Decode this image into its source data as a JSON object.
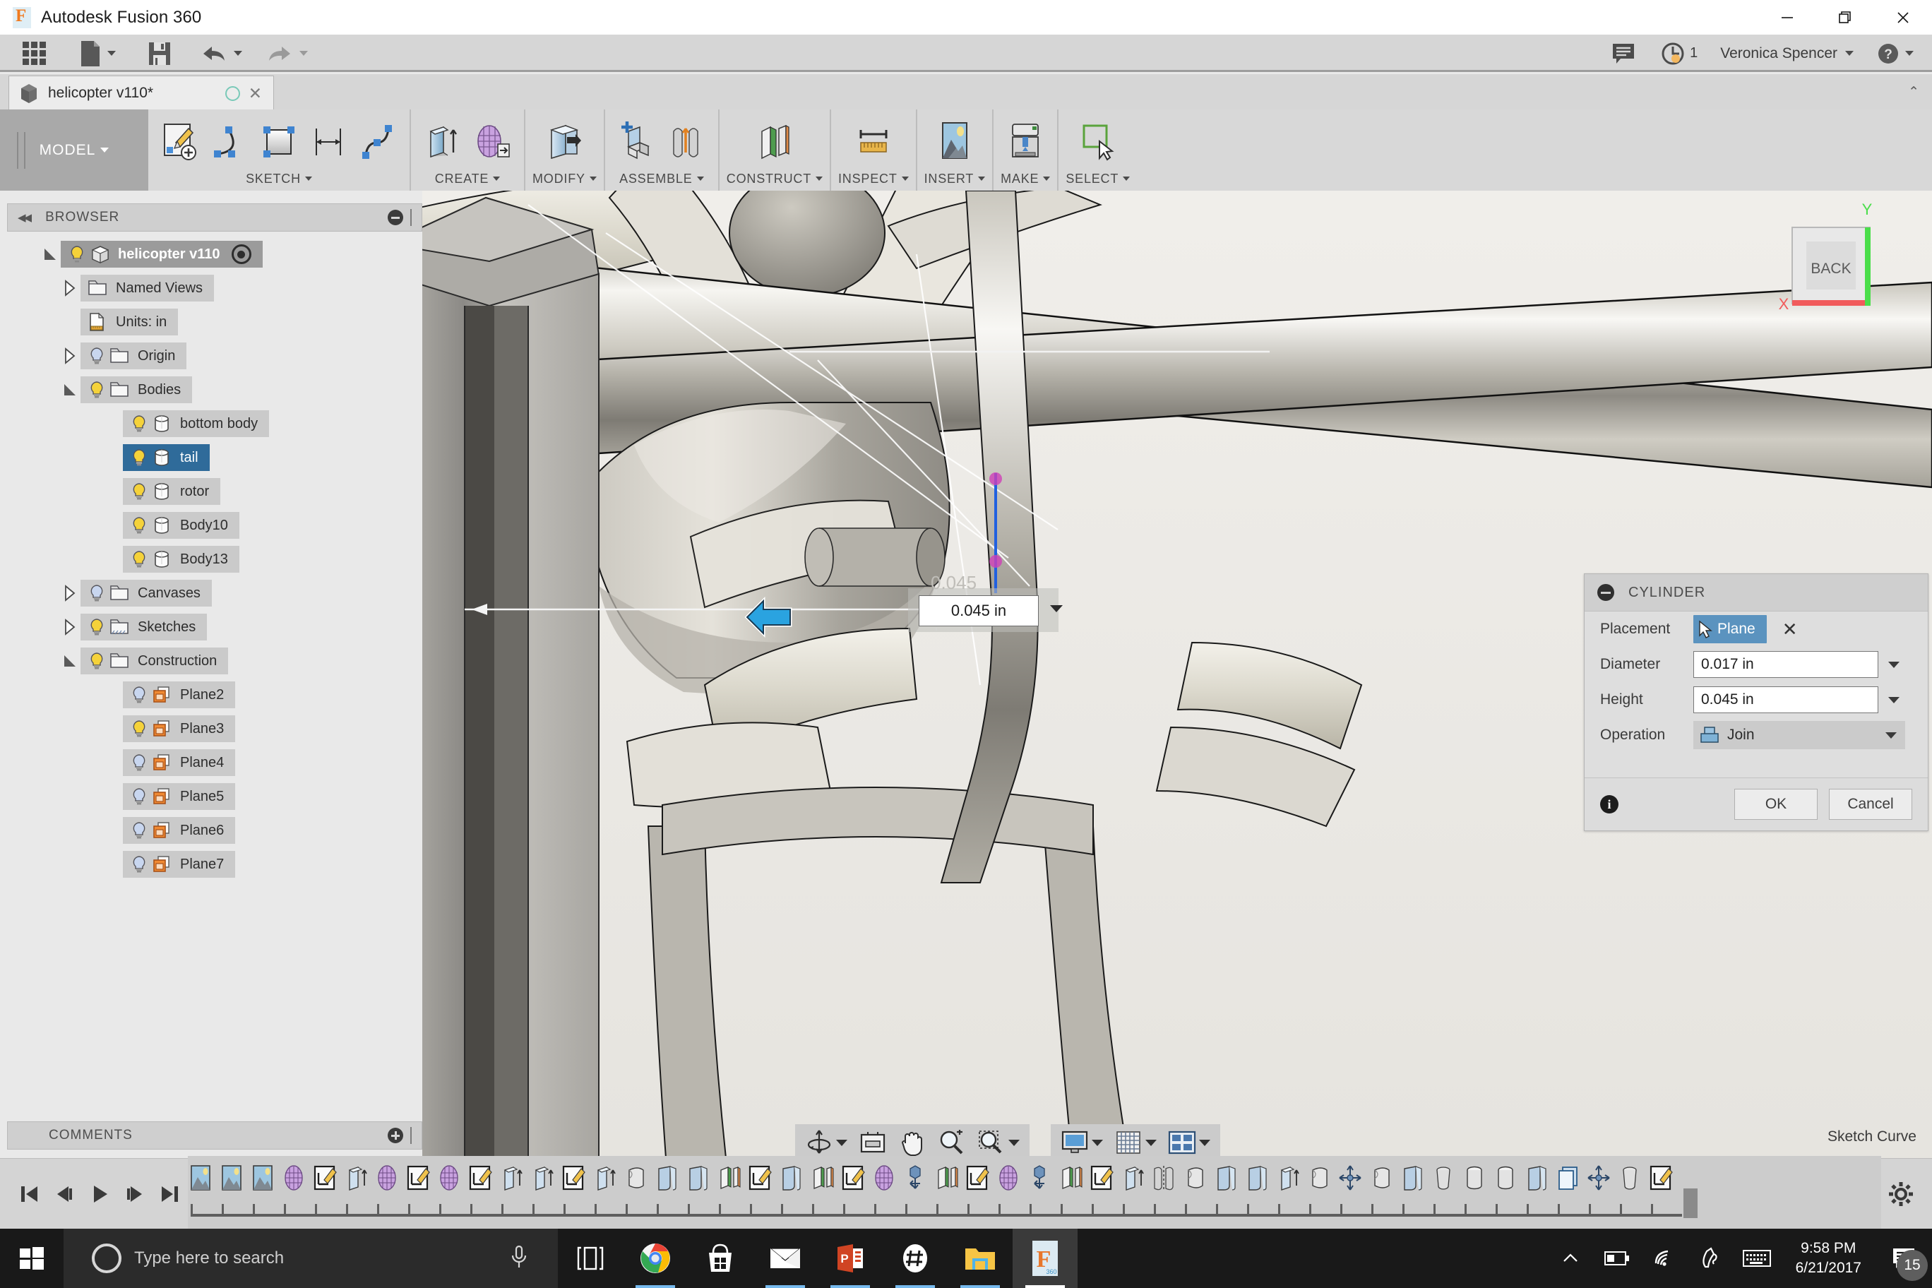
{
  "window": {
    "title": "Autodesk Fusion 360",
    "logo_icon": "fusion-logo-icon",
    "minimize_label": "Minimize",
    "maximize_label": "Restore",
    "close_label": "Close"
  },
  "quick_access": {
    "items": [
      {
        "name": "app-grid",
        "icon": "grid-icon"
      },
      {
        "name": "new-file",
        "icon": "file-icon",
        "has_caret": true
      },
      {
        "name": "save",
        "icon": "save-icon"
      },
      {
        "name": "undo",
        "icon": "undo-icon",
        "has_caret": true
      },
      {
        "name": "redo",
        "icon": "redo-icon",
        "has_caret": true
      }
    ],
    "comments_icon": "comment-icon",
    "jobs_icon": "job-status-icon",
    "jobs_count": "1",
    "user_name": "Veronica Spencer",
    "help_icon": "help-icon"
  },
  "tabs": {
    "document": {
      "label": "helicopter v110*",
      "cube_icon": "cube-icon",
      "sync_icon": "sync-circle-icon",
      "close_icon": "close-icon"
    },
    "collapse_icon": "chevron-up-icon"
  },
  "ribbon": {
    "workspace": "MODEL",
    "panels": [
      {
        "title": "SKETCH",
        "buttons": [
          {
            "name": "create-sketch",
            "icon": "sketch-pencil-icon"
          },
          {
            "name": "sketch-arc",
            "icon": "arc-icon"
          },
          {
            "name": "sketch-rectangle",
            "icon": "rectangle-icon"
          },
          {
            "name": "sketch-dimension",
            "icon": "dimension-icon"
          },
          {
            "name": "sketch-spline",
            "icon": "spline-icon"
          }
        ]
      },
      {
        "title": "CREATE",
        "buttons": [
          {
            "name": "extrude",
            "icon": "extrude-icon"
          },
          {
            "name": "create-form",
            "icon": "form-mesh-icon"
          }
        ]
      },
      {
        "title": "MODIFY",
        "buttons": [
          {
            "name": "press-pull",
            "icon": "press-pull-icon"
          }
        ]
      },
      {
        "title": "ASSEMBLE",
        "buttons": [
          {
            "name": "new-component",
            "icon": "new-component-icon"
          },
          {
            "name": "joint",
            "icon": "joint-icon"
          }
        ]
      },
      {
        "title": "CONSTRUCT",
        "buttons": [
          {
            "name": "offset-plane",
            "icon": "offset-plane-icon"
          }
        ]
      },
      {
        "title": "INSPECT",
        "buttons": [
          {
            "name": "measure",
            "icon": "measure-ruler-icon"
          }
        ]
      },
      {
        "title": "INSERT",
        "buttons": [
          {
            "name": "insert-canvas",
            "icon": "canvas-image-icon"
          }
        ]
      },
      {
        "title": "MAKE",
        "buttons": [
          {
            "name": "3d-print",
            "icon": "3d-print-icon"
          }
        ]
      },
      {
        "title": "SELECT",
        "buttons": [
          {
            "name": "select-tool",
            "icon": "select-cursor-icon"
          }
        ]
      }
    ]
  },
  "browser": {
    "header": "BROWSER",
    "collapse_icon": "double-chevron-left-icon",
    "minimize_icon": "minimize-circle-icon",
    "tree": [
      {
        "label": "helicopter v110",
        "indent": 0,
        "expander": "down",
        "bulb": "on",
        "icon": "component-cube-icon",
        "selected": false,
        "root": true,
        "eyeball": true
      },
      {
        "label": "Named Views",
        "indent": 1,
        "expander": "right",
        "bulb": "none",
        "icon": "folder-icon",
        "selected": false
      },
      {
        "label": "Units: in",
        "indent": 1,
        "expander": "none",
        "bulb": "none",
        "icon": "units-doc-icon",
        "selected": false
      },
      {
        "label": "Origin",
        "indent": 1,
        "expander": "right",
        "bulb": "off",
        "icon": "folder-icon",
        "selected": false
      },
      {
        "label": "Bodies",
        "indent": 1,
        "expander": "down",
        "bulb": "on",
        "icon": "folder-icon",
        "selected": false
      },
      {
        "label": "bottom body",
        "indent": 2,
        "expander": "none",
        "bulb": "on",
        "icon": "body-cylinder-icon",
        "selected": false
      },
      {
        "label": "tail",
        "indent": 2,
        "expander": "none",
        "bulb": "on",
        "icon": "body-cylinder-icon",
        "selected": true
      },
      {
        "label": "rotor",
        "indent": 2,
        "expander": "none",
        "bulb": "on",
        "icon": "body-cylinder-icon",
        "selected": false
      },
      {
        "label": "Body10",
        "indent": 2,
        "expander": "none",
        "bulb": "on",
        "icon": "body-cylinder-icon",
        "selected": false
      },
      {
        "label": "Body13",
        "indent": 2,
        "expander": "none",
        "bulb": "on",
        "icon": "body-cylinder-icon",
        "selected": false
      },
      {
        "label": "Canvases",
        "indent": 1,
        "expander": "right",
        "bulb": "off",
        "icon": "folder-icon",
        "selected": false
      },
      {
        "label": "Sketches",
        "indent": 1,
        "expander": "right",
        "bulb": "on",
        "icon": "folder-sketch-icon",
        "selected": false
      },
      {
        "label": "Construction",
        "indent": 1,
        "expander": "down",
        "bulb": "on",
        "icon": "folder-icon",
        "selected": false
      },
      {
        "label": "Plane2",
        "indent": 2,
        "expander": "none",
        "bulb": "off",
        "icon": "plane-icon",
        "selected": false
      },
      {
        "label": "Plane3",
        "indent": 2,
        "expander": "none",
        "bulb": "on",
        "icon": "plane-icon",
        "selected": false
      },
      {
        "label": "Plane4",
        "indent": 2,
        "expander": "none",
        "bulb": "off",
        "icon": "plane-icon",
        "selected": false
      },
      {
        "label": "Plane5",
        "indent": 2,
        "expander": "none",
        "bulb": "off",
        "icon": "plane-icon",
        "selected": false
      },
      {
        "label": "Plane6",
        "indent": 2,
        "expander": "none",
        "bulb": "off",
        "icon": "plane-icon",
        "selected": false
      },
      {
        "label": "Plane7",
        "indent": 2,
        "expander": "none",
        "bulb": "off",
        "icon": "plane-icon",
        "selected": false
      }
    ]
  },
  "viewport": {
    "viewcube_face": "BACK",
    "axis_x": "X",
    "axis_y": "Y",
    "dimension_value": "0.045 in",
    "dimension_ghost": "0.045",
    "manipulator_icon": "arrow-left-handle-icon"
  },
  "cylinder_dialog": {
    "title": "CYLINDER",
    "collapse_icon": "minimize-circle-icon",
    "placement_label": "Placement",
    "placement_value": "Plane",
    "placement_cursor_icon": "select-cursor-icon",
    "placement_clear_icon": "x-icon",
    "diameter_label": "Diameter",
    "diameter_value": "0.017 in",
    "height_label": "Height",
    "height_value": "0.045 in",
    "operation_label": "Operation",
    "operation_value": "Join",
    "operation_icon": "join-icon",
    "info_icon": "info-icon",
    "ok_label": "OK",
    "cancel_label": "Cancel",
    "accent_color": "#5b93bf"
  },
  "comments": {
    "header": "COMMENTS",
    "add_icon": "plus-circle-icon"
  },
  "navbar": {
    "group1": [
      {
        "name": "orbit",
        "icon": "orbit-icon",
        "has_caret": true
      },
      {
        "name": "fit",
        "icon": "fit-icon"
      },
      {
        "name": "pan",
        "icon": "pan-hand-icon"
      },
      {
        "name": "zoom",
        "icon": "zoom-icon"
      },
      {
        "name": "zoom-window",
        "icon": "zoom-window-icon",
        "has_caret": true
      }
    ],
    "group2": [
      {
        "name": "display-settings",
        "icon": "display-monitor-icon",
        "has_caret": true
      },
      {
        "name": "grid-snaps",
        "icon": "grid-snap-icon",
        "has_caret": true
      },
      {
        "name": "viewports",
        "icon": "viewports-icon",
        "has_caret": true
      }
    ],
    "status_text": "Sketch Curve"
  },
  "timeline": {
    "playback": [
      {
        "name": "go-to-beginning",
        "icon": "skip-start-icon"
      },
      {
        "name": "step-back",
        "icon": "step-back-icon"
      },
      {
        "name": "play",
        "icon": "play-icon"
      },
      {
        "name": "step-forward",
        "icon": "step-forward-icon"
      },
      {
        "name": "go-to-end",
        "icon": "skip-end-icon"
      }
    ],
    "features": [
      "canvas",
      "canvas",
      "canvas",
      "form",
      "sketch",
      "extrude",
      "form",
      "sketch",
      "form",
      "sketch",
      "extrude",
      "extrude",
      "sketch",
      "extrude",
      "revolve",
      "fillet",
      "fillet",
      "plane",
      "sketch",
      "fillet",
      "plane",
      "sketch",
      "form",
      "joint",
      "plane",
      "sketch",
      "form",
      "joint",
      "plane",
      "sketch",
      "extrude",
      "mirror",
      "revolve",
      "fillet",
      "fillet",
      "extrude",
      "revolve",
      "move",
      "revolve",
      "fillet",
      "loft",
      "cylinder",
      "cylinder",
      "fillet",
      "copy",
      "move",
      "loft",
      "sketch"
    ],
    "settings_icon": "gear-icon"
  },
  "taskbar": {
    "start_icon": "windows-logo-icon",
    "search_placeholder": "Type here to search",
    "cortana_icon": "cortana-circle-icon",
    "mic_icon": "microphone-icon",
    "apps": [
      {
        "name": "task-view",
        "icon": "task-view-icon",
        "active": false,
        "pinned": false
      },
      {
        "name": "chrome",
        "icon": "chrome-icon",
        "active": true,
        "pinned": true
      },
      {
        "name": "microsoft-store",
        "icon": "store-bag-icon",
        "active": false,
        "pinned": true
      },
      {
        "name": "mail",
        "icon": "mail-envelope-icon",
        "active": true,
        "pinned": true
      },
      {
        "name": "powerpoint",
        "icon": "powerpoint-icon",
        "active": true,
        "pinned": true
      },
      {
        "name": "slack",
        "icon": "slack-hash-icon",
        "active": true,
        "pinned": true
      },
      {
        "name": "file-explorer",
        "icon": "folder-explorer-icon",
        "active": true,
        "pinned": true
      },
      {
        "name": "fusion-360",
        "icon": "fusion-360-icon",
        "active": true,
        "pinned": true,
        "running": true
      }
    ],
    "tray": [
      {
        "name": "show-hidden-icons",
        "icon": "chevron-up-icon"
      },
      {
        "name": "battery",
        "icon": "battery-icon"
      },
      {
        "name": "network",
        "icon": "wifi-icon"
      },
      {
        "name": "pen-workspace",
        "icon": "pen-icon"
      },
      {
        "name": "touch-keyboard",
        "icon": "keyboard-icon"
      }
    ],
    "time": "9:58 PM",
    "date": "6/21/2017",
    "notification_icon": "notification-icon",
    "notification_count": "15"
  }
}
